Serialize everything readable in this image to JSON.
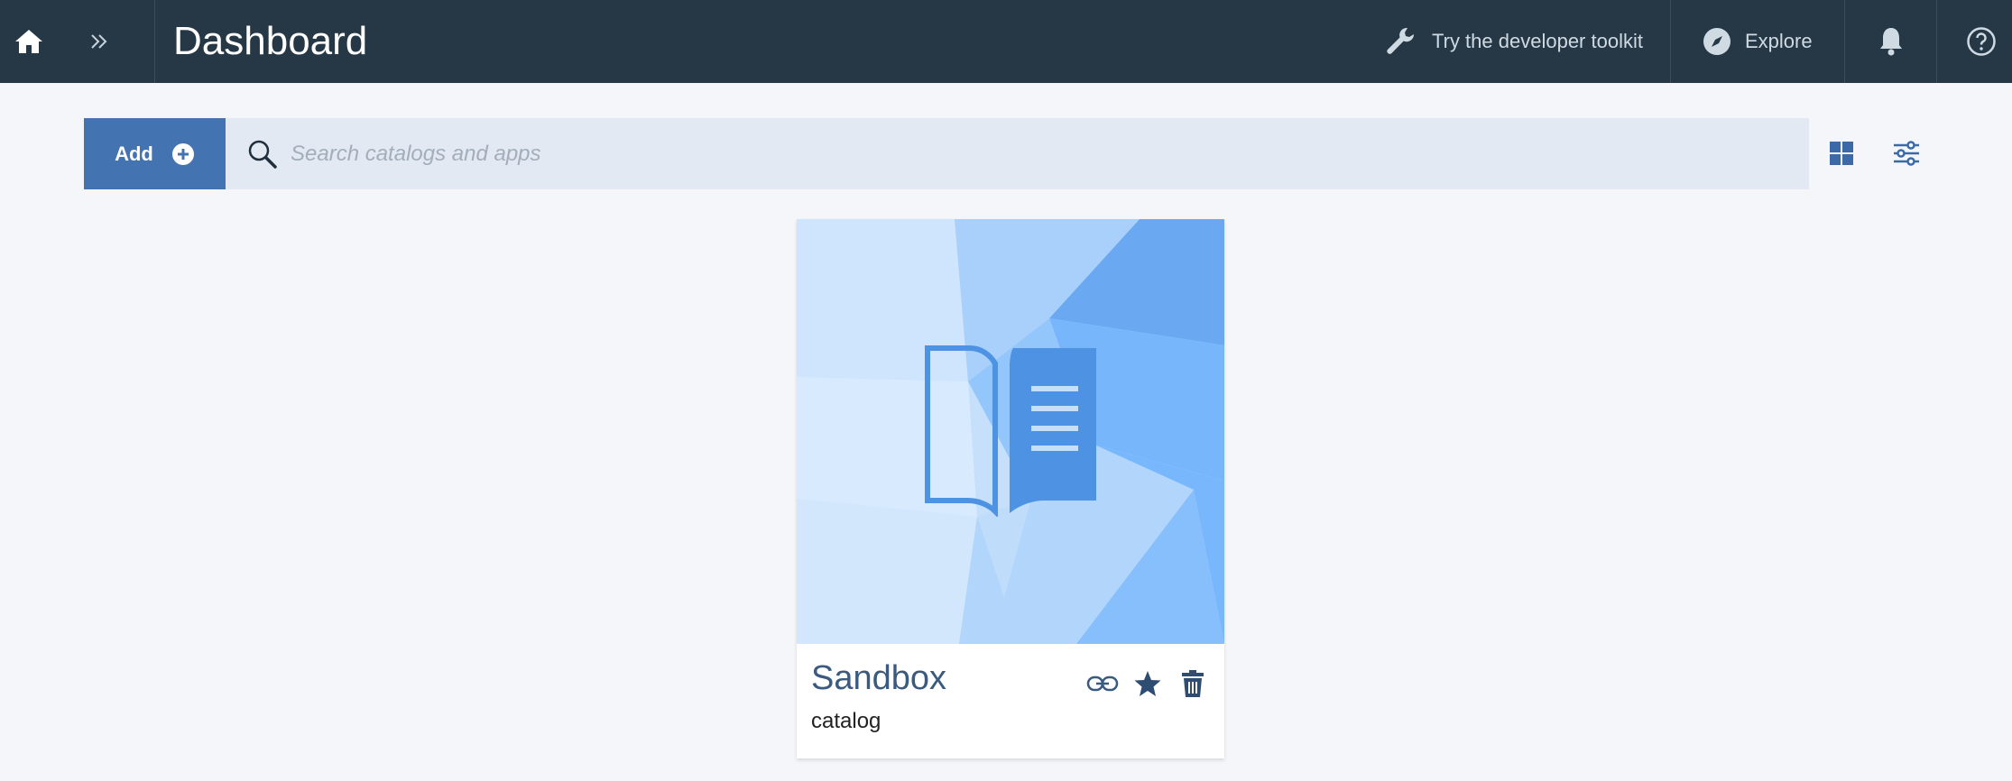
{
  "header": {
    "title": "Dashboard",
    "nav": {
      "toolkit_label": "Try the developer toolkit",
      "explore_label": "Explore"
    },
    "icons": [
      "home-icon",
      "double-chevron-right-icon",
      "wrench-icon",
      "compass-icon",
      "bell-icon",
      "help-icon"
    ]
  },
  "toolbar": {
    "add_label": "Add",
    "search_placeholder": "Search catalogs and apps",
    "search_value": ""
  },
  "cards": [
    {
      "title": "Sandbox",
      "subtitle": "catalog",
      "icon": "open-book-icon"
    }
  ],
  "colors": {
    "header_bg": "#263846",
    "accent": "#4473b1",
    "search_bg": "#e2e9f3",
    "page_bg": "#f4f6f9",
    "card_title": "#3a5a80"
  }
}
